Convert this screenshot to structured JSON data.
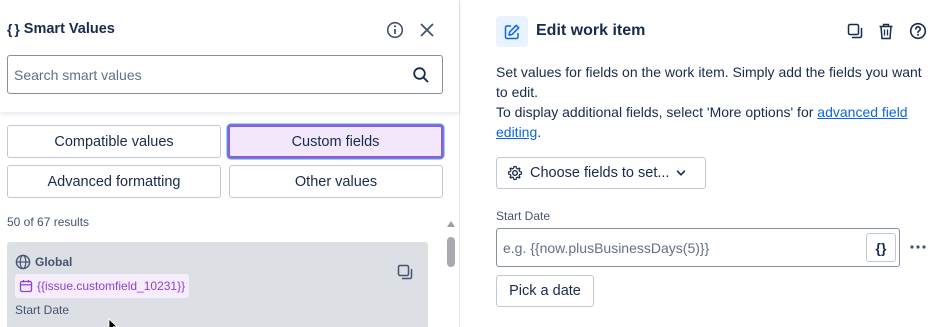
{
  "smart_values_panel": {
    "title": "Smart Values",
    "title_icon": "braces-icon",
    "search": {
      "placeholder": "Search smart values",
      "value": ""
    },
    "tabs": [
      {
        "label": "Compatible values",
        "selected": false
      },
      {
        "label": "Custom fields",
        "selected": true
      },
      {
        "label": "Advanced formatting",
        "selected": false
      },
      {
        "label": "Other values",
        "selected": false
      }
    ],
    "results_count": "50 of 67 results",
    "results": [
      {
        "scope": "Global",
        "smart_value": "{{issue.customfield_10231}}",
        "label": "Start Date"
      }
    ]
  },
  "edit_panel": {
    "title": "Edit work item",
    "description_line1": "Set values for fields on the work item. Simply add the fields you want to edit.",
    "description_line2_prefix": "To display additional fields, select 'More options' for ",
    "description_link": "advanced field editing",
    "description_line2_suffix": ".",
    "choose_fields_label": "Choose fields to set...",
    "field": {
      "label": "Start Date",
      "placeholder": "e.g. {{now.plusBusinessDays(5)}}",
      "value": "",
      "smart_value_button": "{}"
    },
    "pick_date_label": "Pick a date"
  },
  "colors": {
    "accent_purple": "#8f5bd9",
    "selected_tab_bg": "#f3e7fb",
    "link_blue": "#0c66e4",
    "chip_text": "#8f3fd6"
  }
}
